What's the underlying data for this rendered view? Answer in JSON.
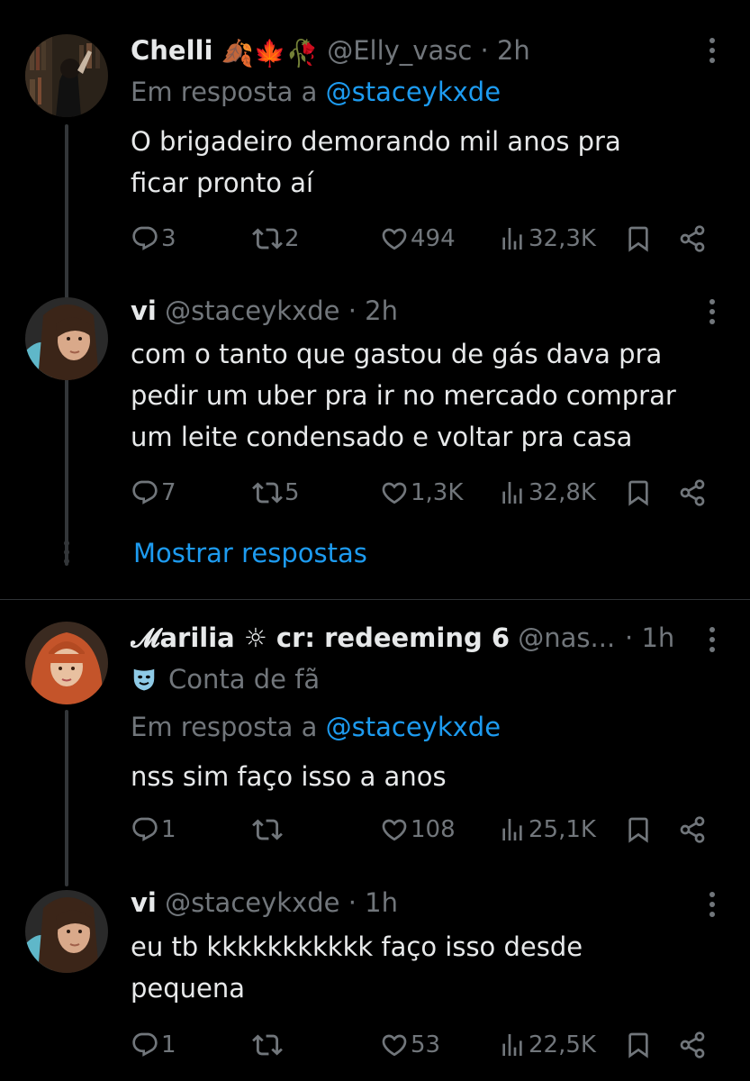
{
  "tweets": [
    {
      "name": "Chelli",
      "name_emoji": "🍂🍁🥀",
      "handle": "@Elly_vasc",
      "time": "2h",
      "reply_prefix": "Em resposta a",
      "reply_to": "@staceykxde",
      "text_lines": [
        "O brigadeiro demorando mil anos pra",
        "ficar pronto aí"
      ],
      "replies": "3",
      "reposts": "2",
      "likes": "494",
      "views": "32,3K"
    },
    {
      "name": "vi",
      "handle": "@staceykxde",
      "time": "2h",
      "text_lines": [
        "com o tanto que gastou de gás dava pra",
        "pedir um uber pra ir no mercado comprar",
        "um leite condensado e voltar pra casa"
      ],
      "replies": "7",
      "reposts": "5",
      "likes": "1,3K",
      "views": "32,8K"
    },
    {
      "name": "𝓜arilia ☼ cr: redeeming 6",
      "handle": "@nas...",
      "time": "1h",
      "badge": "Conta de fã",
      "reply_prefix": "Em resposta a",
      "reply_to": "@staceykxde",
      "text_lines": [
        "nss sim faço isso a anos"
      ],
      "replies": "1",
      "reposts": "",
      "likes": "108",
      "views": "25,1K"
    },
    {
      "name": "vi",
      "handle": "@staceykxde",
      "time": "1h",
      "text_lines": [
        "eu tb kkkkkkkkkkk faço isso desde",
        "pequena"
      ],
      "replies": "1",
      "reposts": "",
      "likes": "53",
      "views": "22,5K"
    }
  ],
  "show_replies": "Mostrar respostas",
  "separator": "·",
  "colors": {
    "background": "#000000",
    "text": "#e7e9ea",
    "muted": "#71767b",
    "link": "#1d9bf0",
    "divider": "#2f3336"
  }
}
